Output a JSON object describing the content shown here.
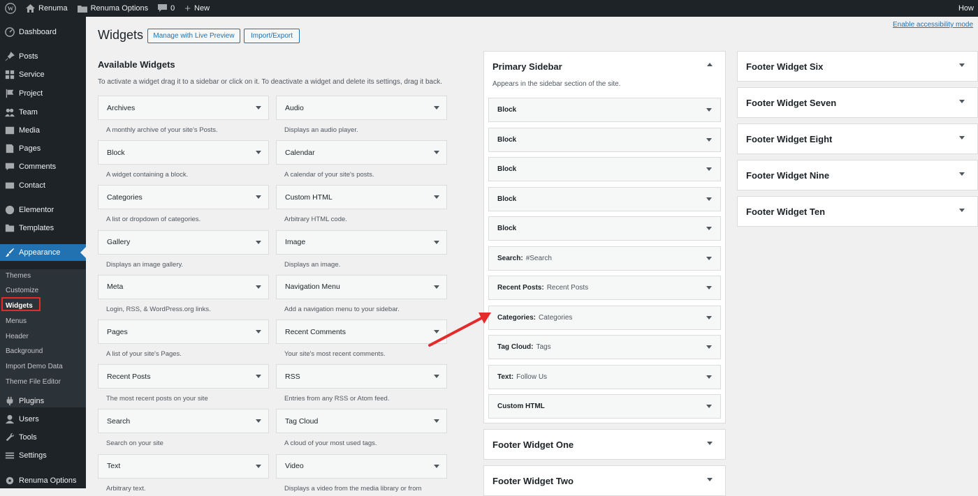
{
  "adminbar": {
    "site_name": "Renuma",
    "options": "Renuma Options",
    "comments_count": "0",
    "new_label": "New",
    "howdy": "How"
  },
  "menu": {
    "top_items": [
      {
        "label": "Dashboard",
        "icon": "dashboard-icon"
      },
      {
        "label": "Posts",
        "icon": "pin-icon"
      },
      {
        "label": "Service",
        "icon": "grid-icon"
      },
      {
        "label": "Project",
        "icon": "flag-icon"
      },
      {
        "label": "Team",
        "icon": "team-icon"
      },
      {
        "label": "Media",
        "icon": "media-icon"
      },
      {
        "label": "Pages",
        "icon": "page-icon"
      },
      {
        "label": "Comments",
        "icon": "comment-icon"
      },
      {
        "label": "Contact",
        "icon": "mail-icon"
      },
      {
        "label": "Elementor",
        "icon": "elementor-icon"
      },
      {
        "label": "Templates",
        "icon": "folder-icon"
      },
      {
        "label": "Appearance",
        "icon": "brush-icon"
      }
    ],
    "submenu": [
      "Themes",
      "Customize",
      "Widgets",
      "Menus",
      "Header",
      "Background",
      "Import Demo Data",
      "Theme File Editor"
    ],
    "bottom_items": [
      {
        "label": "Plugins",
        "icon": "plugin-icon"
      },
      {
        "label": "Users",
        "icon": "user-icon"
      },
      {
        "label": "Tools",
        "icon": "wrench-icon"
      },
      {
        "label": "Settings",
        "icon": "settings-icon"
      },
      {
        "label": "Renuma Options",
        "icon": "gear-icon"
      }
    ]
  },
  "page": {
    "title": "Widgets",
    "live_preview": "Manage with Live Preview",
    "import_export": "Import/Export",
    "accessibility": "Enable accessibility mode"
  },
  "available": {
    "title": "Available Widgets",
    "description": "To activate a widget drag it to a sidebar or click on it. To deactivate a widget and delete its settings, drag it back.",
    "left": [
      {
        "name": "Archives",
        "desc": "A monthly archive of your site's Posts."
      },
      {
        "name": "Block",
        "desc": "A widget containing a block."
      },
      {
        "name": "Categories",
        "desc": "A list or dropdown of categories."
      },
      {
        "name": "Gallery",
        "desc": "Displays an image gallery."
      },
      {
        "name": "Meta",
        "desc": "Login, RSS, & WordPress.org links."
      },
      {
        "name": "Pages",
        "desc": "A list of your site's Pages."
      },
      {
        "name": "Recent Posts",
        "desc": "The most recent posts on your site"
      },
      {
        "name": "Search",
        "desc": "Search on your site"
      },
      {
        "name": "Text",
        "desc": "Arbitrary text."
      }
    ],
    "right": [
      {
        "name": "Audio",
        "desc": "Displays an audio player."
      },
      {
        "name": "Calendar",
        "desc": "A calendar of your site's posts."
      },
      {
        "name": "Custom HTML",
        "desc": "Arbitrary HTML code."
      },
      {
        "name": "Image",
        "desc": "Displays an image."
      },
      {
        "name": "Navigation Menu",
        "desc": "Add a navigation menu to your sidebar."
      },
      {
        "name": "Recent Comments",
        "desc": "Your site's most recent comments."
      },
      {
        "name": "RSS",
        "desc": "Entries from any RSS or Atom feed."
      },
      {
        "name": "Tag Cloud",
        "desc": "A cloud of your most used tags."
      },
      {
        "name": "Video",
        "desc": "Displays a video from the media library or from"
      }
    ]
  },
  "primary_sidebar": {
    "title": "Primary Sidebar",
    "description": "Appears in the sidebar section of the site.",
    "widgets": [
      {
        "title": "Block",
        "sub": ""
      },
      {
        "title": "Block",
        "sub": ""
      },
      {
        "title": "Block",
        "sub": ""
      },
      {
        "title": "Block",
        "sub": ""
      },
      {
        "title": "Block",
        "sub": ""
      },
      {
        "title": "Search:",
        "sub": "#Search"
      },
      {
        "title": "Recent Posts:",
        "sub": "Recent Posts"
      },
      {
        "title": "Categories:",
        "sub": "Categories"
      },
      {
        "title": "Tag Cloud:",
        "sub": "Tags"
      },
      {
        "title": "Text:",
        "sub": "Follow Us"
      },
      {
        "title": "Custom HTML",
        "sub": ""
      }
    ]
  },
  "footer_areas_middle": [
    "Footer Widget One",
    "Footer Widget Two"
  ],
  "footer_areas_right": [
    "Footer Widget Six",
    "Footer Widget Seven",
    "Footer Widget Eight",
    "Footer Widget Nine",
    "Footer Widget Ten"
  ],
  "colors": {
    "admin_dark": "#1d2327",
    "accent": "#2271b1",
    "highlight": "#e32b2b"
  }
}
